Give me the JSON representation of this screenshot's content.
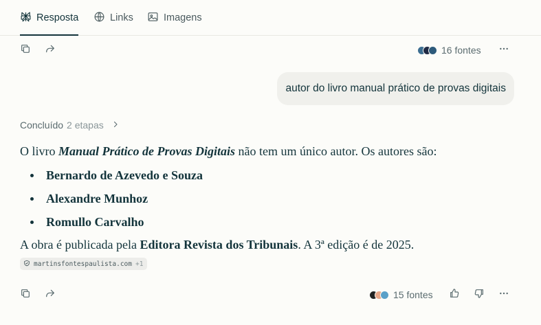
{
  "tabs": [
    {
      "label": "Resposta",
      "icon": "perplexity-logo-icon",
      "active": true
    },
    {
      "label": "Links",
      "icon": "globe-icon",
      "active": false
    },
    {
      "label": "Imagens",
      "icon": "image-icon",
      "active": false
    }
  ],
  "top_bar": {
    "sources_label": "16 fontes",
    "favicon_colors": [
      "#3c6e91",
      "#1f2a44",
      "#2d5a7b"
    ]
  },
  "query": "autor do livro manual prático de provas digitais",
  "steps": {
    "status": "Concluído",
    "count": "2 etapas"
  },
  "answer": {
    "intro_prefix": "O livro ",
    "book_title": "Manual Prático de Provas Digitais",
    "intro_suffix": " não tem um único autor. Os autores são:",
    "authors": [
      "Bernardo de Azevedo e Souza",
      "Alexandre Munhoz",
      "Romullo Carvalho"
    ],
    "outro_prefix": "A obra é publicada pela ",
    "publisher": "Editora Revista dos Tribunais",
    "outro_suffix": ". A 3ª edição é de 2025."
  },
  "citation": {
    "domain": "martinsfontespaulista.com",
    "extra": "+1"
  },
  "bottom_bar": {
    "sources_label": "15 fontes",
    "favicon_colors": [
      "#222222",
      "#e8a88a",
      "#5aa0c8"
    ]
  }
}
